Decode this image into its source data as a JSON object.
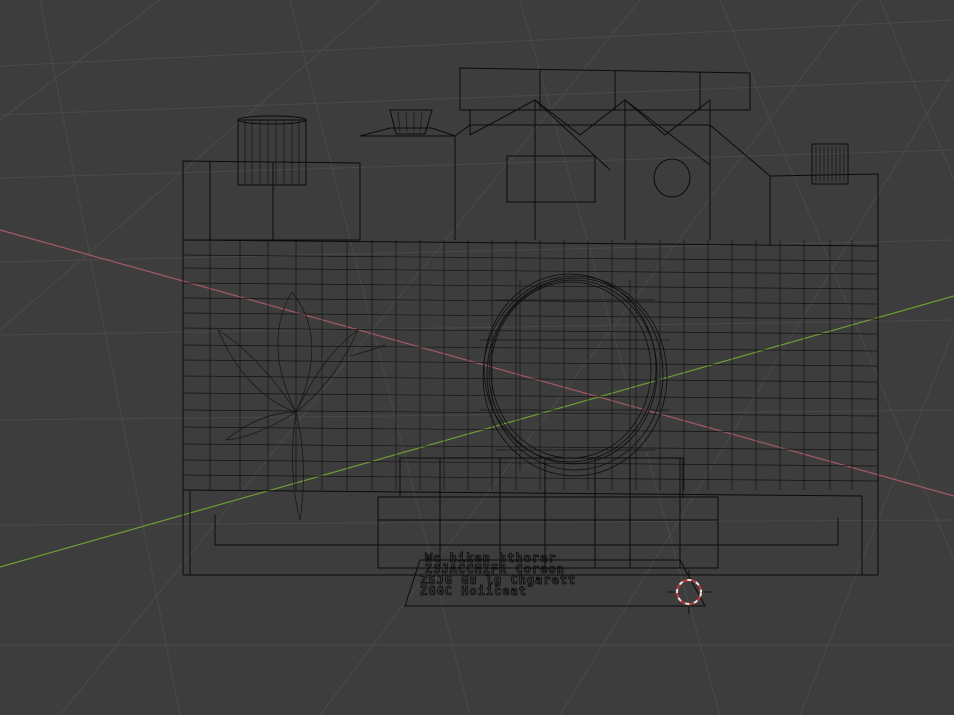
{
  "viewport": {
    "background_color": "#3d3d3d",
    "grid_color": "#4a4a4a",
    "wire_color": "#0b0b0b",
    "x_axis_color": "#a45a62",
    "y_axis_color": "#6f9c33",
    "cursor_colors": [
      "#c9363a",
      "#e8e8e8"
    ]
  },
  "model": {
    "object_name": "camera",
    "shading": "wireframe"
  },
  "plate": {
    "lines": [
      "Wo hiken hthorer",
      "ZSJACCHIFR Coreon",
      "ZSJG Gu lg Chgarett",
      "ZGGC Hoiiceat"
    ]
  },
  "icons": {
    "cursor": "3d-cursor-icon"
  }
}
